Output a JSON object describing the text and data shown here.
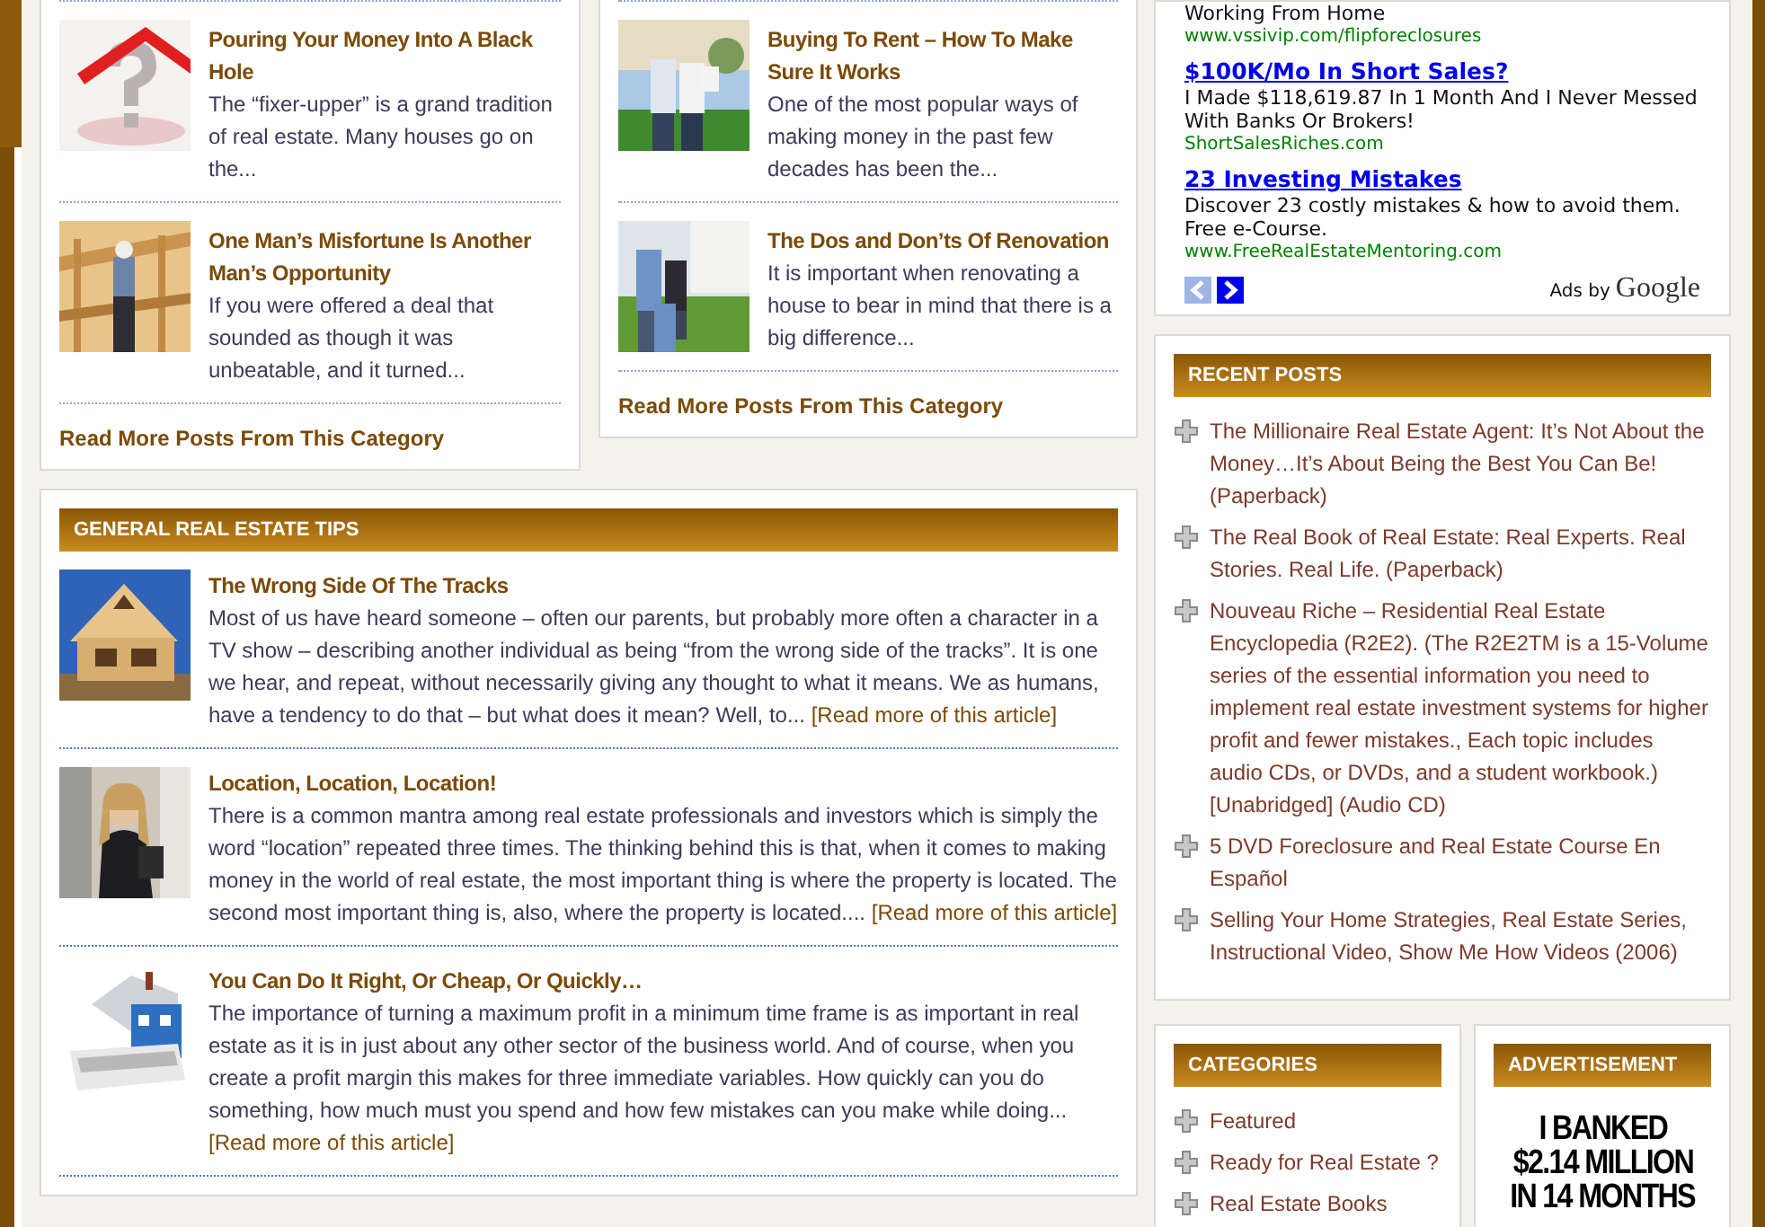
{
  "top_columns": [
    {
      "posts": [
        {
          "title": "Pouring Your Money Into A Black Hole",
          "excerpt": "The “fixer-upper” is a grand tradition of real estate. Many houses go on the..."
        },
        {
          "title": "One Man’s Misfortune Is Another Man’s Opportunity",
          "excerpt": "If you were offered a deal that sounded as though it was unbeatable, and it turned..."
        }
      ],
      "read_more": "Read More Posts From This Category"
    },
    {
      "posts": [
        {
          "title": "Buying To Rent – How To Make Sure It Works",
          "excerpt": "One of the most popular ways of making money in the past few decades has been the..."
        },
        {
          "title": "The Dos and Don’ts Of Renovation",
          "excerpt": "It is important when renovating a house to bear in mind that there is a big difference..."
        }
      ],
      "read_more": "Read More Posts From This Category"
    }
  ],
  "tips_section": {
    "heading": "GENERAL REAL ESTATE TIPS",
    "posts": [
      {
        "title": "The Wrong Side Of The Tracks",
        "excerpt": "Most of us have heard someone – often our parents, but probably more often a character in a TV show – describing another individual as being “from the wrong side of the tracks”. It is one we hear, and repeat, without necessarily giving any thought to what it means. We as humans, have a tendency to do that – but what does it mean? Well, to...",
        "read_more": "[Read more of this article]"
      },
      {
        "title": "Location, Location, Location!",
        "excerpt": "There is a common mantra among real estate professionals and investors which is simply the word “location” repeated three times. The thinking behind this is that, when it comes to making money in the world of real estate, the most important thing is where the property is located. The second most important thing is, also, where the property is located....",
        "read_more": "[Read more of this article]"
      },
      {
        "title": "You Can Do It Right, Or Cheap, Or Quickly…",
        "excerpt": "The importance of turning a maximum profit in a minimum time frame is as important in real estate as it is in just about any other sector of the business world. And of course, when you create a profit margin this makes for three immediate variables. How quickly can you do something, how much must you spend and how few mistakes can you make while doing...",
        "read_more": "[Read more of this article]"
      }
    ]
  },
  "ad_unit": {
    "ads": [
      {
        "text": "Working From Home",
        "url": "www.vssivip.com/flipforeclosures"
      },
      {
        "title": "$100K/Mo In Short Sales?",
        "text": "I Made $118,619.87 In 1 Month And I Never Messed With Banks Or Brokers!",
        "url": "ShortSalesRiches.com"
      },
      {
        "title": "23 Investing Mistakes",
        "text": "Discover 23 costly mistakes & how to avoid them. Free e-Course.",
        "url": "www.FreeRealEstateMentoring.com"
      }
    ],
    "prev_disabled": true,
    "next_disabled": false,
    "ads_by": "Ads by",
    "brand": "Google"
  },
  "recent_posts": {
    "heading": "RECENT POSTS",
    "items": [
      "The Millionaire Real Estate Agent: It’s Not About the Money…It’s About Being the Best You Can Be! (Paperback)",
      "The Real Book of Real Estate: Real Experts. Real Stories. Real Life. (Paperback)",
      "Nouveau Riche – Residential Real Estate Encyclopedia (R2E2). (The R2E2TM is a 15-Volume series of the essential information you need to implement real estate investment systems for higher profit and fewer mistakes., Each topic includes audio CDs, or DVDs, and a student workbook.) [Unabridged] (Audio CD)",
      "5 DVD Foreclosure and Real Estate Course En Español",
      "Selling Your Home Strategies, Real Estate Series, Instructional Video, Show Me How Videos (2006)"
    ]
  },
  "categories": {
    "heading": "CATEGORIES",
    "items": [
      "Featured",
      "Ready for Real Estate ?",
      "Real Estate Books"
    ]
  },
  "advertisement": {
    "heading": "ADVERTISEMENT",
    "banner_lines": [
      "I BANKED",
      "$2.14 MILLION",
      "IN 14 MONTHS"
    ]
  }
}
